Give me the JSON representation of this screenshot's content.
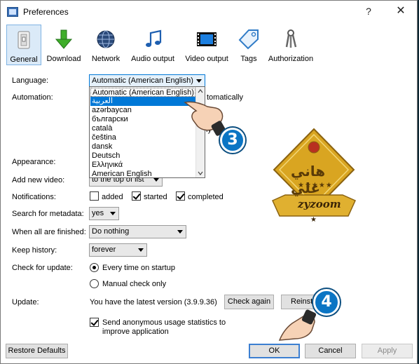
{
  "window": {
    "title": "Preferences",
    "help_label": "?",
    "close_label": "✕"
  },
  "toolbar": [
    {
      "label": "General",
      "icon": "general-icon"
    },
    {
      "label": "Download",
      "icon": "download-arrow-icon"
    },
    {
      "label": "Network",
      "icon": "globe-icon"
    },
    {
      "label": "Audio output",
      "icon": "music-note-icon"
    },
    {
      "label": "Video output",
      "icon": "film-strip-icon"
    },
    {
      "label": "Tags",
      "icon": "tag-icon"
    },
    {
      "label": "Authorization",
      "icon": "keys-icon"
    }
  ],
  "form": {
    "language": {
      "label": "Language:",
      "value": "Automatic (American English)"
    },
    "automation": {
      "label": "Automation:",
      "hidden_text_1": "tomatically",
      "hidden_text_2": "ly"
    },
    "appearance": {
      "label": "Appearance:"
    },
    "add_new_video": {
      "label": "Add new video:",
      "value": "to the top of list"
    },
    "notifications": {
      "label": "Notifications:",
      "options": [
        {
          "label": "added",
          "checked": false
        },
        {
          "label": "started",
          "checked": true
        },
        {
          "label": "completed",
          "checked": true
        }
      ]
    },
    "search_for_metadata": {
      "label": "Search for metadata:",
      "value": "yes"
    },
    "when_all_finished": {
      "label": "When all are finished:",
      "value": "Do nothing"
    },
    "keep_history": {
      "label": "Keep history:",
      "value": "forever"
    },
    "check_for_update": {
      "label": "Check for update:",
      "options": [
        {
          "label": "Every time on startup",
          "selected": true
        },
        {
          "label": "Manual check only",
          "selected": false
        }
      ]
    },
    "update": {
      "label": "Update:",
      "status": "You have the latest version (3.9.9.36)",
      "check_again": "Check again",
      "reinstall": "Reinst"
    },
    "anonymous_stats": {
      "label": "Send anonymous usage statistics to improve application",
      "line1": "Send anonymous usage statistics to",
      "line2": "improve application",
      "checked": true
    }
  },
  "language_list": {
    "items": [
      "Automatic (American English)",
      "العربية",
      "azərbaycan",
      "български",
      "català",
      "čeština",
      "dansk",
      "Deutsch",
      "Ελληνικά",
      "American English"
    ],
    "selected_index": 1
  },
  "footer": {
    "restore_defaults": "Restore Defaults",
    "ok": "OK",
    "cancel": "Cancel",
    "apply": "Apply"
  },
  "overlay": {
    "step3": "3",
    "step4": "4",
    "watermark_name": "هاني علي",
    "watermark_brand": "zyzoom",
    "watermark_stars": "★★★★★",
    "watermark_star_small": "★"
  },
  "colors": {
    "accent": "#0078d7",
    "step_badge": "#0b75c4",
    "badge_gold": "#d9a521"
  }
}
